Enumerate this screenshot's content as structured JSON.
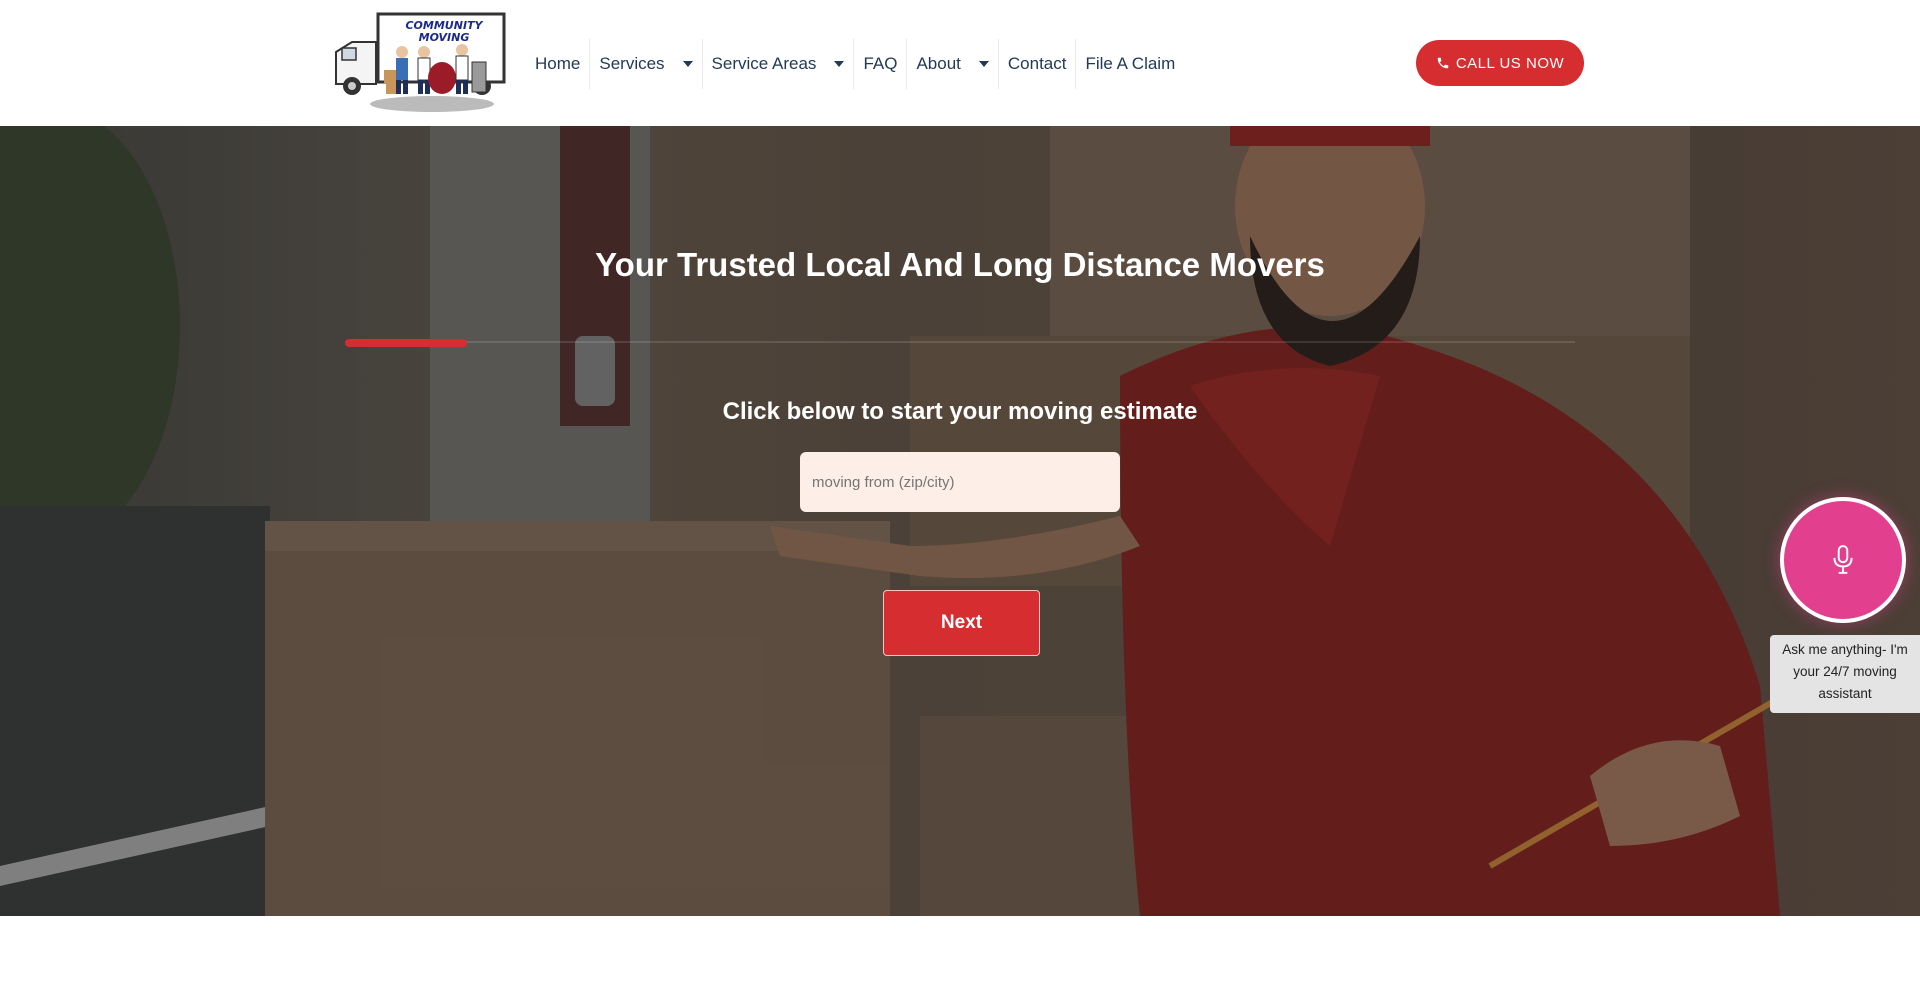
{
  "header": {
    "logo_text": "COMMUNITY MOVING",
    "nav": [
      {
        "label": "Home",
        "has_dropdown": false
      },
      {
        "label": "Services",
        "has_dropdown": true
      },
      {
        "label": "Service Areas",
        "has_dropdown": true
      },
      {
        "label": "FAQ",
        "has_dropdown": false
      },
      {
        "label": "About",
        "has_dropdown": true
      },
      {
        "label": "Contact",
        "has_dropdown": false
      },
      {
        "label": "File A Claim",
        "has_dropdown": false
      }
    ],
    "call_button": "CALL US NOW"
  },
  "hero": {
    "title": "Your Trusted Local And Long Distance Movers",
    "subtitle": "Click below to start your moving estimate",
    "zip_placeholder": "moving from (zip/city)",
    "next_button": "Next"
  },
  "assistant": {
    "tooltip": "Ask me anything- I'm your 24/7 moving assistant"
  },
  "colors": {
    "accent": "#d62d31",
    "nav_text": "#233a56",
    "assistant": "#e2408f",
    "input_bg": "#fdefe7"
  }
}
